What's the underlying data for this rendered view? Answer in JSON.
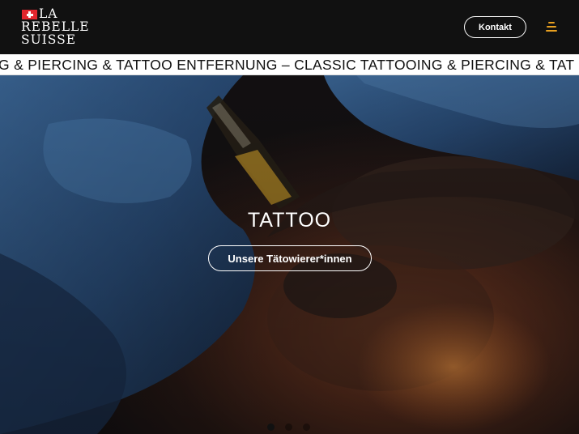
{
  "header": {
    "logo": {
      "line1": "LA",
      "line2": "REBELLE",
      "line3": "SUISSE"
    },
    "contact_label": "Kontakt",
    "menu_icon": "menu-icon"
  },
  "marquee": {
    "text": "G & PIERCING & TATTOO ENTFERNUNG – CLASSIC TATTOOING & PIERCING & TAT"
  },
  "hero": {
    "title": "TATTOO",
    "button_label": "Unsere Tätowierer*innen",
    "slides": [
      {
        "active": true
      },
      {
        "active": false
      },
      {
        "active": false
      }
    ]
  },
  "colors": {
    "header_bg": "#111111",
    "accent": "#e8a020",
    "flag_red": "#e1262d",
    "marquee_bg": "#ffffff"
  }
}
